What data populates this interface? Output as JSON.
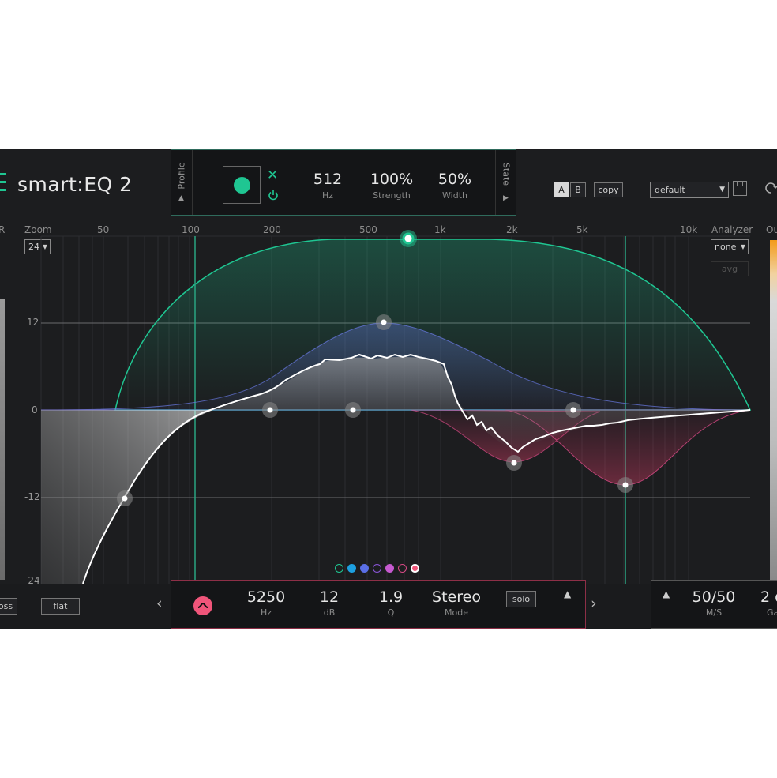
{
  "app": {
    "title": "smart:EQ 2"
  },
  "profile": {
    "side_label": "Profile"
  },
  "state": {
    "side_label": "State"
  },
  "main_params": [
    {
      "value": "512",
      "label": "Hz"
    },
    {
      "value": "100%",
      "label": "Strength"
    },
    {
      "value": "50%",
      "label": "Width"
    }
  ],
  "ab": {
    "a": "A",
    "b": "B",
    "copy": "copy"
  },
  "preset": {
    "value": "default"
  },
  "zoom": {
    "label": "Zoom",
    "value": "24"
  },
  "analyzer": {
    "label": "Analyzer",
    "value": "none",
    "avg": "avg"
  },
  "left_edge_label": "R",
  "right_edge_label": "Ou",
  "freq_labels": [
    "50",
    "100",
    "200",
    "500",
    "1k",
    "2k",
    "5k",
    "10k"
  ],
  "db_labels": [
    "12",
    "0",
    "-12",
    "-24"
  ],
  "bottom": {
    "bypass_label": "oss",
    "flat_label": "flat",
    "band": {
      "params": [
        {
          "value": "5250",
          "label": "Hz"
        },
        {
          "value": "12",
          "label": "dB"
        },
        {
          "value": "1.9",
          "label": "Q"
        },
        {
          "value": "Stereo",
          "label": "Mode"
        }
      ],
      "solo_label": "solo"
    },
    "output": {
      "ms_value": "50/50",
      "ms_label": "M/S",
      "gain_value": "2 d",
      "gain_label": "Ga"
    }
  },
  "band_dot_colors": [
    "#1fc692",
    "#1da0e0",
    "#5a6fe6",
    "#8a55d8",
    "#c65ad0",
    "#d84a86",
    "#f0557a"
  ],
  "colors": {
    "accent_green": "#1fc692",
    "accent_pink": "#f0557a",
    "background": "#1c1d1f"
  }
}
